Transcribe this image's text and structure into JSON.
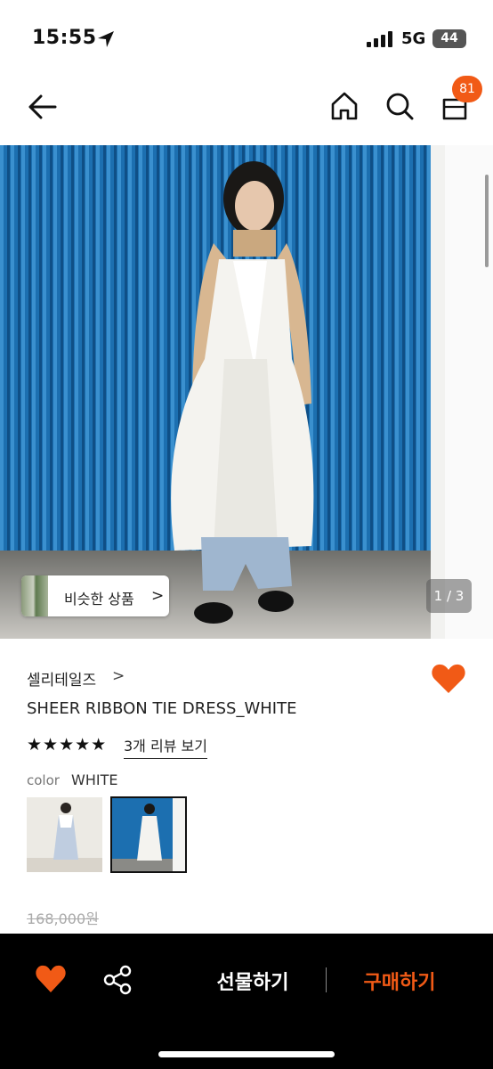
{
  "status_bar": {
    "time": "15:55",
    "network": "5G",
    "battery": "44"
  },
  "nav": {
    "cart_count": "81"
  },
  "hero": {
    "similar_label": "비슷한 상품",
    "similar_chevron": ">",
    "pager": "1 / 3"
  },
  "product": {
    "brand": "셀리테일즈",
    "brand_chevron": ">",
    "title": "SHEER RIBBON TIE DRESS_WHITE",
    "rating": 4.5,
    "stars_display": "★★★★★",
    "review_link": "3개 리뷰 보기",
    "color_label": "color",
    "color_value": "WHITE",
    "original_price": "168,000원"
  },
  "bottom_bar": {
    "gift_label": "선물하기",
    "buy_label": "구매하기"
  },
  "colors": {
    "accent": "#f15a16",
    "bottom_bar_bg": "#000000"
  },
  "icons": [
    "location-arrow-icon",
    "signal-icon",
    "back-arrow-icon",
    "home-icon",
    "search-icon",
    "shopping-bag-icon",
    "heart-icon",
    "share-icon"
  ]
}
